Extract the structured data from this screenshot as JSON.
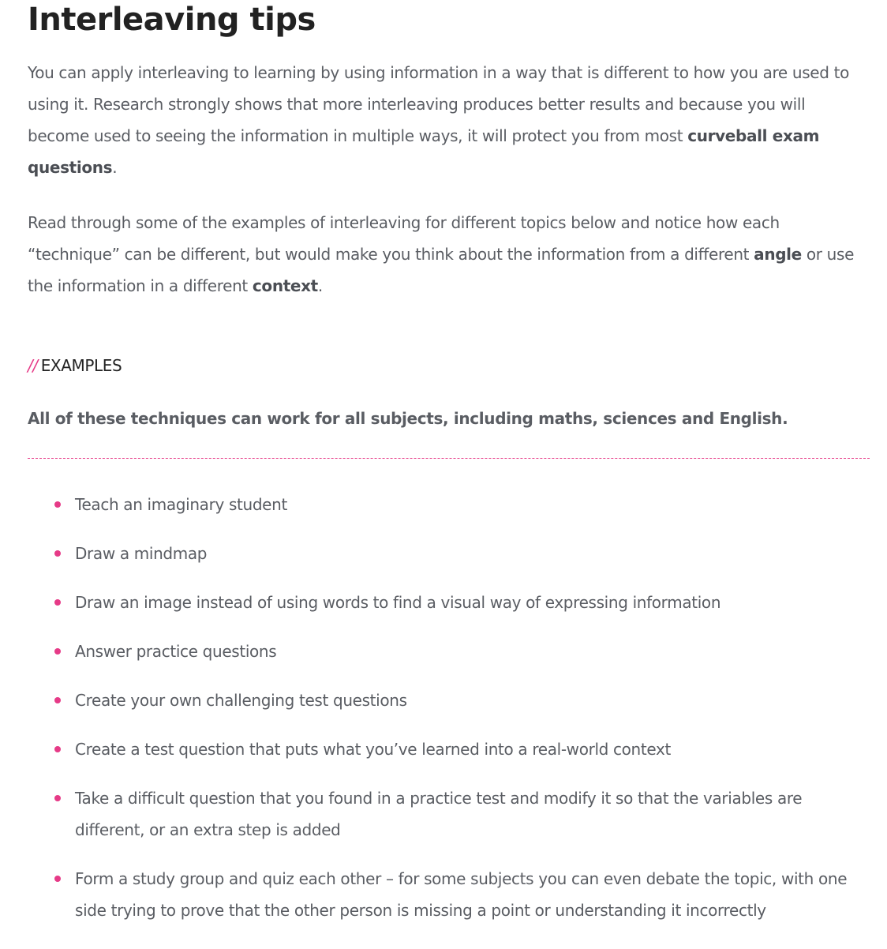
{
  "title": "Interleaving tips",
  "intro": {
    "p1_text": "You can apply interleaving to learning by using information in a way that is different to how you are used to using it. Research strongly shows that more interleaving produces better results and because you will become used to seeing the information in multiple ways, it will protect you from most ",
    "p1_bold": "curveball exam questions",
    "p1_end": ".",
    "p2_text_a": "Read through some of the examples of interleaving for different topics below and notice how each “technique” can be different, but would make you think about the information from a different ",
    "p2_bold_a": "angle",
    "p2_text_b": " or use the information in a different ",
    "p2_bold_b": "context",
    "p2_end": "."
  },
  "section": {
    "slashes": "//",
    "label": "EXAMPLES",
    "lead": "All of these techniques can work for all subjects, including maths, sciences and English."
  },
  "examples": [
    "Teach an imaginary student",
    "Draw a mindmap",
    "Draw an image instead of using words to find a visual way of expressing information",
    "Answer practice questions",
    "Create your own challenging test questions",
    "Create a test question that puts what you’ve learned into a real-world context",
    "Take a difficult question that you found in a practice test and modify it so that the variables are different, or an extra step is added",
    "Form a study group and quiz each other – for some subjects you can even debate the topic, with one side trying to prove that the other person is missing a point or understanding it incorrectly"
  ],
  "colors": {
    "accent": "#e63a87",
    "heading": "#222222",
    "body_text": "#5a5d63"
  },
  "icons": {
    "bullet": "pink-dot-bullet-icon"
  }
}
